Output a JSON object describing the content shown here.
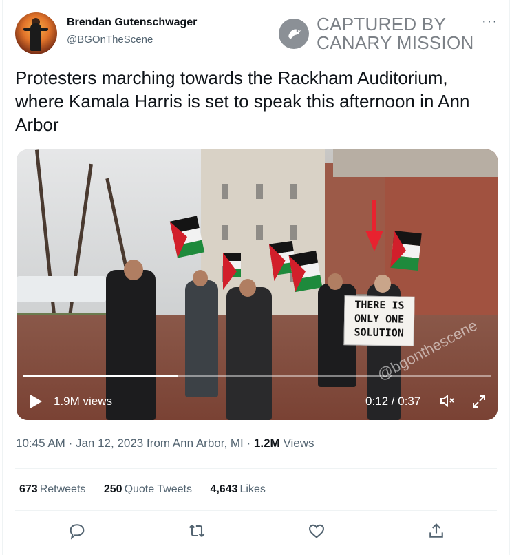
{
  "author": {
    "name": "Brendan Gutenschwager",
    "handle": "@BGOnTheScene"
  },
  "watermark_brand": {
    "line1": "CAPTURED BY",
    "line2": "CANARY MISSION"
  },
  "more_label": "···",
  "tweet": {
    "text": "Protesters marching towards the Rackham Auditorium, where Kamala Harris is set to speak this afternoon in Ann Arbor"
  },
  "video": {
    "views_label": "1.9M views",
    "time_label": "0:12 / 0:37",
    "progress_fraction": 0.33,
    "sign_text": "THERE IS ONLY ONE SOLUTION",
    "watermark_text": "@bgonthescene"
  },
  "meta": {
    "time": "10:45 AM",
    "date": "Jan 12, 2023",
    "location": "from Ann Arbor, MI",
    "views_count": "1.2M",
    "views_label": "Views"
  },
  "stats": {
    "retweets_count": "673",
    "retweets_label": "Retweets",
    "quotes_count": "250",
    "quotes_label": "Quote Tweets",
    "likes_count": "4,643",
    "likes_label": "Likes"
  },
  "colors": {
    "text_primary": "#0f1419",
    "text_secondary": "#536471",
    "divider": "#eff3f4",
    "arrow_red": "#e8222f"
  },
  "icons": [
    "reply-icon",
    "retweet-icon",
    "like-icon",
    "share-icon",
    "play-icon",
    "volume-icon",
    "fullscreen-icon",
    "more-icon"
  ]
}
